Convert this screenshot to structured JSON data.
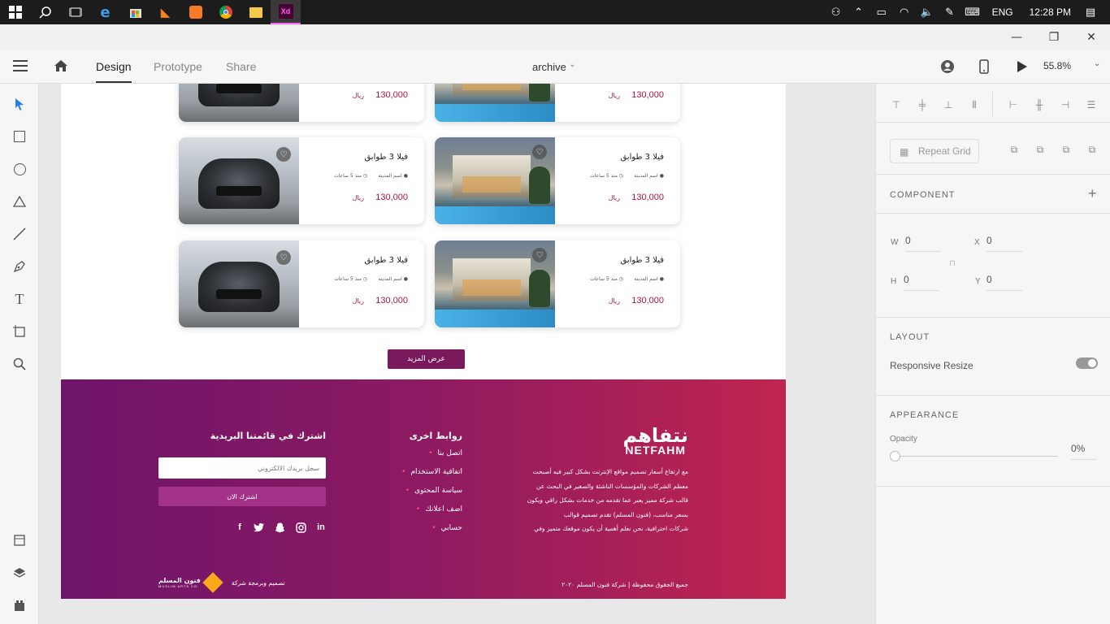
{
  "taskbar": {
    "language": "ENG",
    "time": "12:28 PM"
  },
  "appbar": {
    "tabs": [
      {
        "label": "Design"
      },
      {
        "label": "Prototype"
      },
      {
        "label": "Share"
      }
    ],
    "document_title": "archive",
    "zoom": "55.8%"
  },
  "page": {
    "cards": [
      {
        "price": "130,000",
        "currency": "ريال"
      },
      {
        "price": "130,000",
        "currency": "ريال"
      },
      {
        "title": "فيلا 3 طوابق",
        "city": "اسم المدينة",
        "time": "منذ 5 ساعات",
        "price": "130,000",
        "currency": "ريال"
      },
      {
        "title": "فيلا 3 طوابق",
        "city": "اسم المدينة",
        "time": "منذ 5 ساعات",
        "price": "130,000",
        "currency": "ريال"
      },
      {
        "title": "فيلا 3 طوابق",
        "city": "اسم المدينة",
        "time": "منذ 5 ساعات",
        "price": "130,000",
        "currency": "ريال"
      },
      {
        "title": "فيلا 3 طوابق",
        "city": "اسم المدينة",
        "time": "منذ 5 ساعات",
        "price": "130,000",
        "currency": "ريال"
      }
    ],
    "more_button": "عرض المزيد"
  },
  "footer": {
    "logo_ar": "نتفاهم",
    "logo_en": "NETFAHM",
    "about_lines": [
      "مع ارتفاع أسعار تصميم مواقع الإنترنت بشكل كبير فيه أصبحت",
      "معظم الشركات والمؤسسات الناشئة والصغير في البحث عن",
      "قالب شركة مميز يعبر عما تقدمه من خدمات بشكل راقي ويكون",
      "بسعر مناسب، (فنون المسلم) تقدم تصميم قوالب",
      "شركات احترافية، نحن نعلم أهمية أن يكون موقعك متميز وفي"
    ],
    "links_title": "روابط اخرى",
    "links": [
      "اتصل بنا",
      "اتفاقية الاستخدام",
      "سياسة المحتوى",
      "اضف اعلانك",
      "حسابي"
    ],
    "newsletter_title": "اشترك في قائمتنا البريدية",
    "newsletter_placeholder": "سجل بريدك الالكتروني",
    "subscribe_label": "اشترك الان",
    "social": [
      "facebook-icon",
      "twitter-icon",
      "snapchat-icon",
      "instagram-icon",
      "linkedin-icon"
    ],
    "copyright": "جميع الحقوق محفوظة | شركة فنون المسلم ٢٠٢٠",
    "credit": "تصميم وبرمجة شركة",
    "credit_logo_ar": "فنون المسلم",
    "credit_logo_en": "MUSLIM ARTS CO."
  },
  "rightpanel": {
    "repeat_grid": "Repeat Grid",
    "component_label": "COMPONENT",
    "w_label": "W",
    "w_value": "0",
    "h_label": "H",
    "h_value": "0",
    "x_label": "X",
    "x_value": "0",
    "y_label": "Y",
    "y_value": "0",
    "layout_label": "LAYOUT",
    "responsive_resize": "Responsive Resize",
    "responsive_resize_on": true,
    "appearance_label": "APPEARANCE",
    "opacity_label": "Opacity",
    "opacity_value": "0%"
  }
}
